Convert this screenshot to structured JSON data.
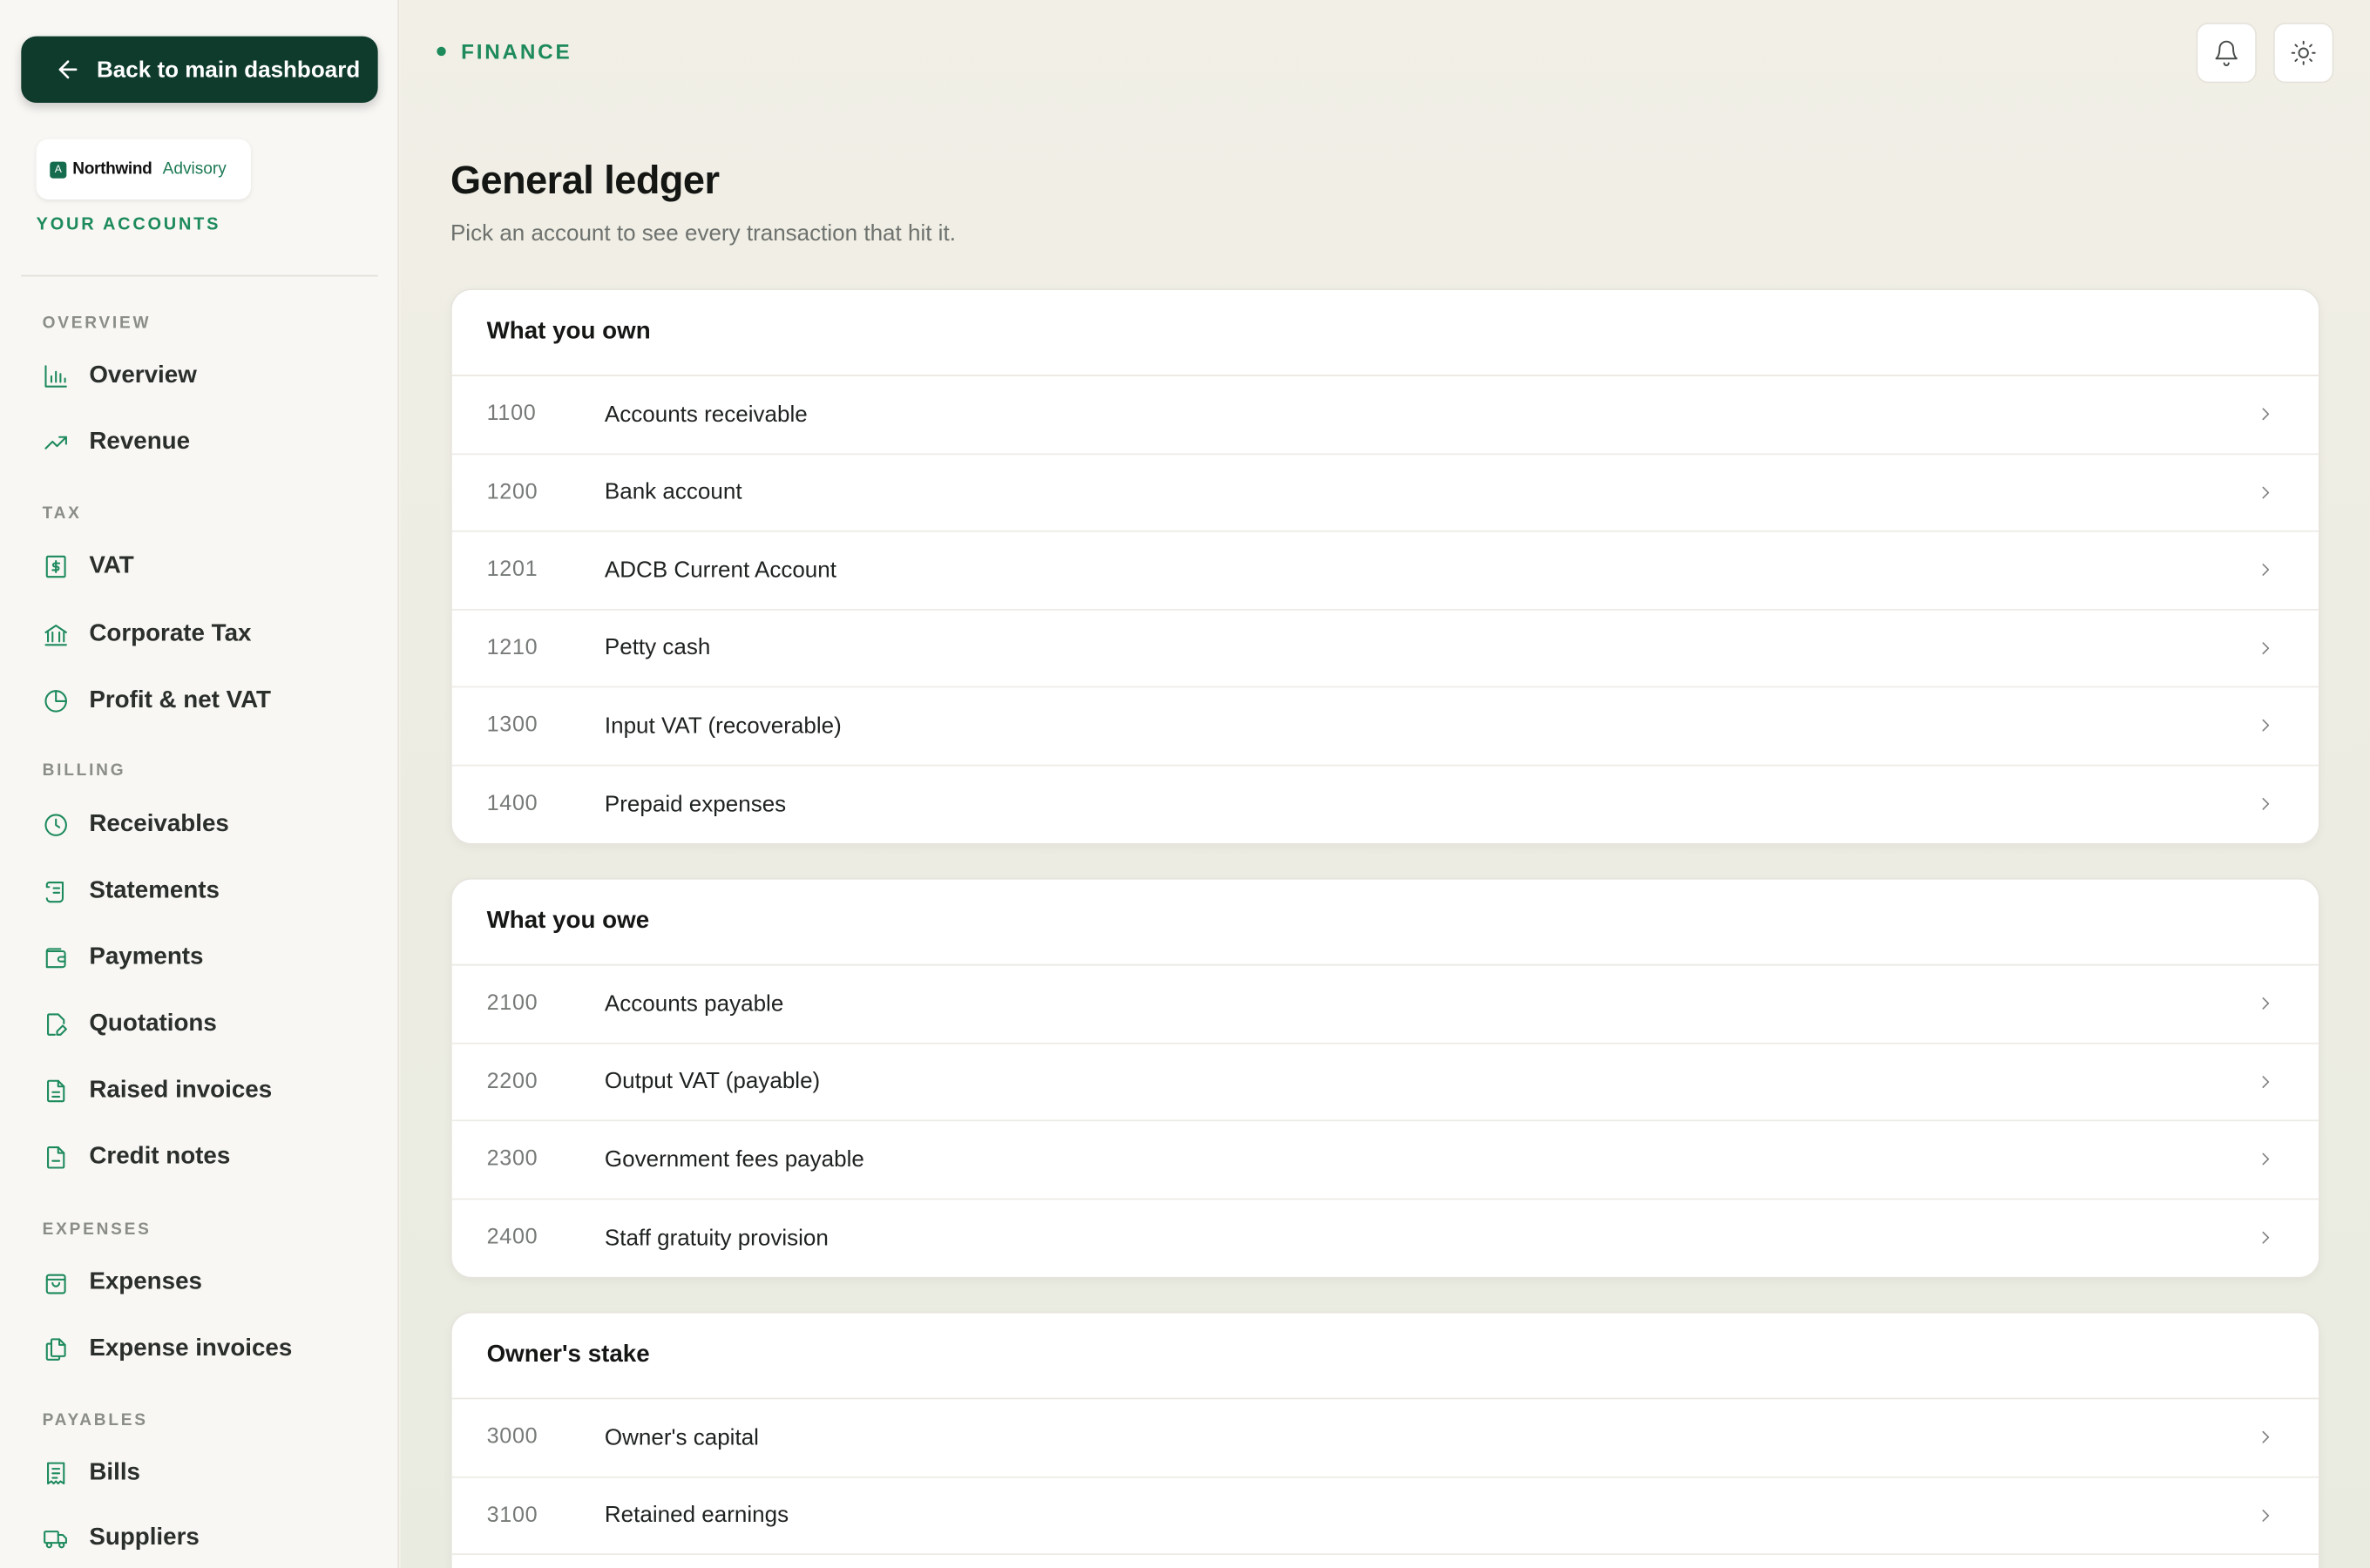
{
  "sidebar": {
    "back_label": "Back to main dashboard",
    "brand": {
      "mark": "A",
      "name": "Northwind",
      "sub": "Advisory"
    },
    "your_accounts": "YOUR ACCOUNTS",
    "sections": {
      "overview": "OVERVIEW",
      "tax": "TAX",
      "billing": "BILLING",
      "expenses": "EXPENSES",
      "payables": "PAYABLES"
    },
    "items": {
      "overview": "Overview",
      "revenue": "Revenue",
      "vat": "VAT",
      "corporate_tax": "Corporate Tax",
      "profit_vat": "Profit & net VAT",
      "receivables": "Receivables",
      "statements": "Statements",
      "payments": "Payments",
      "quotations": "Quotations",
      "raised_invoices": "Raised invoices",
      "credit_notes": "Credit notes",
      "expenses": "Expenses",
      "expense_invoices": "Expense invoices",
      "bills": "Bills",
      "suppliers": "Suppliers"
    }
  },
  "header": {
    "breadcrumb": "FINANCE",
    "notifications_icon": "bell-icon",
    "theme_icon": "sun-icon"
  },
  "main": {
    "title": "General ledger",
    "subtitle": "Pick an account to see every transaction that hit it.",
    "groups": [
      {
        "title": "What you own",
        "accounts": [
          {
            "code": "1100",
            "name": "Accounts receivable"
          },
          {
            "code": "1200",
            "name": "Bank account"
          },
          {
            "code": "1201",
            "name": "ADCB Current Account"
          },
          {
            "code": "1210",
            "name": "Petty cash"
          },
          {
            "code": "1300",
            "name": "Input VAT (recoverable)"
          },
          {
            "code": "1400",
            "name": "Prepaid expenses"
          }
        ]
      },
      {
        "title": "What you owe",
        "accounts": [
          {
            "code": "2100",
            "name": "Accounts payable"
          },
          {
            "code": "2200",
            "name": "Output VAT (payable)"
          },
          {
            "code": "2300",
            "name": "Government fees payable"
          },
          {
            "code": "2400",
            "name": "Staff gratuity provision"
          }
        ]
      },
      {
        "title": "Owner's stake",
        "accounts": [
          {
            "code": "3000",
            "name": "Owner's capital"
          },
          {
            "code": "3100",
            "name": "Retained earnings"
          },
          {
            "code": "",
            "name": ""
          }
        ]
      }
    ]
  },
  "colors": {
    "accent": "#1d8a5c",
    "back_button": "#0f3b2c"
  }
}
